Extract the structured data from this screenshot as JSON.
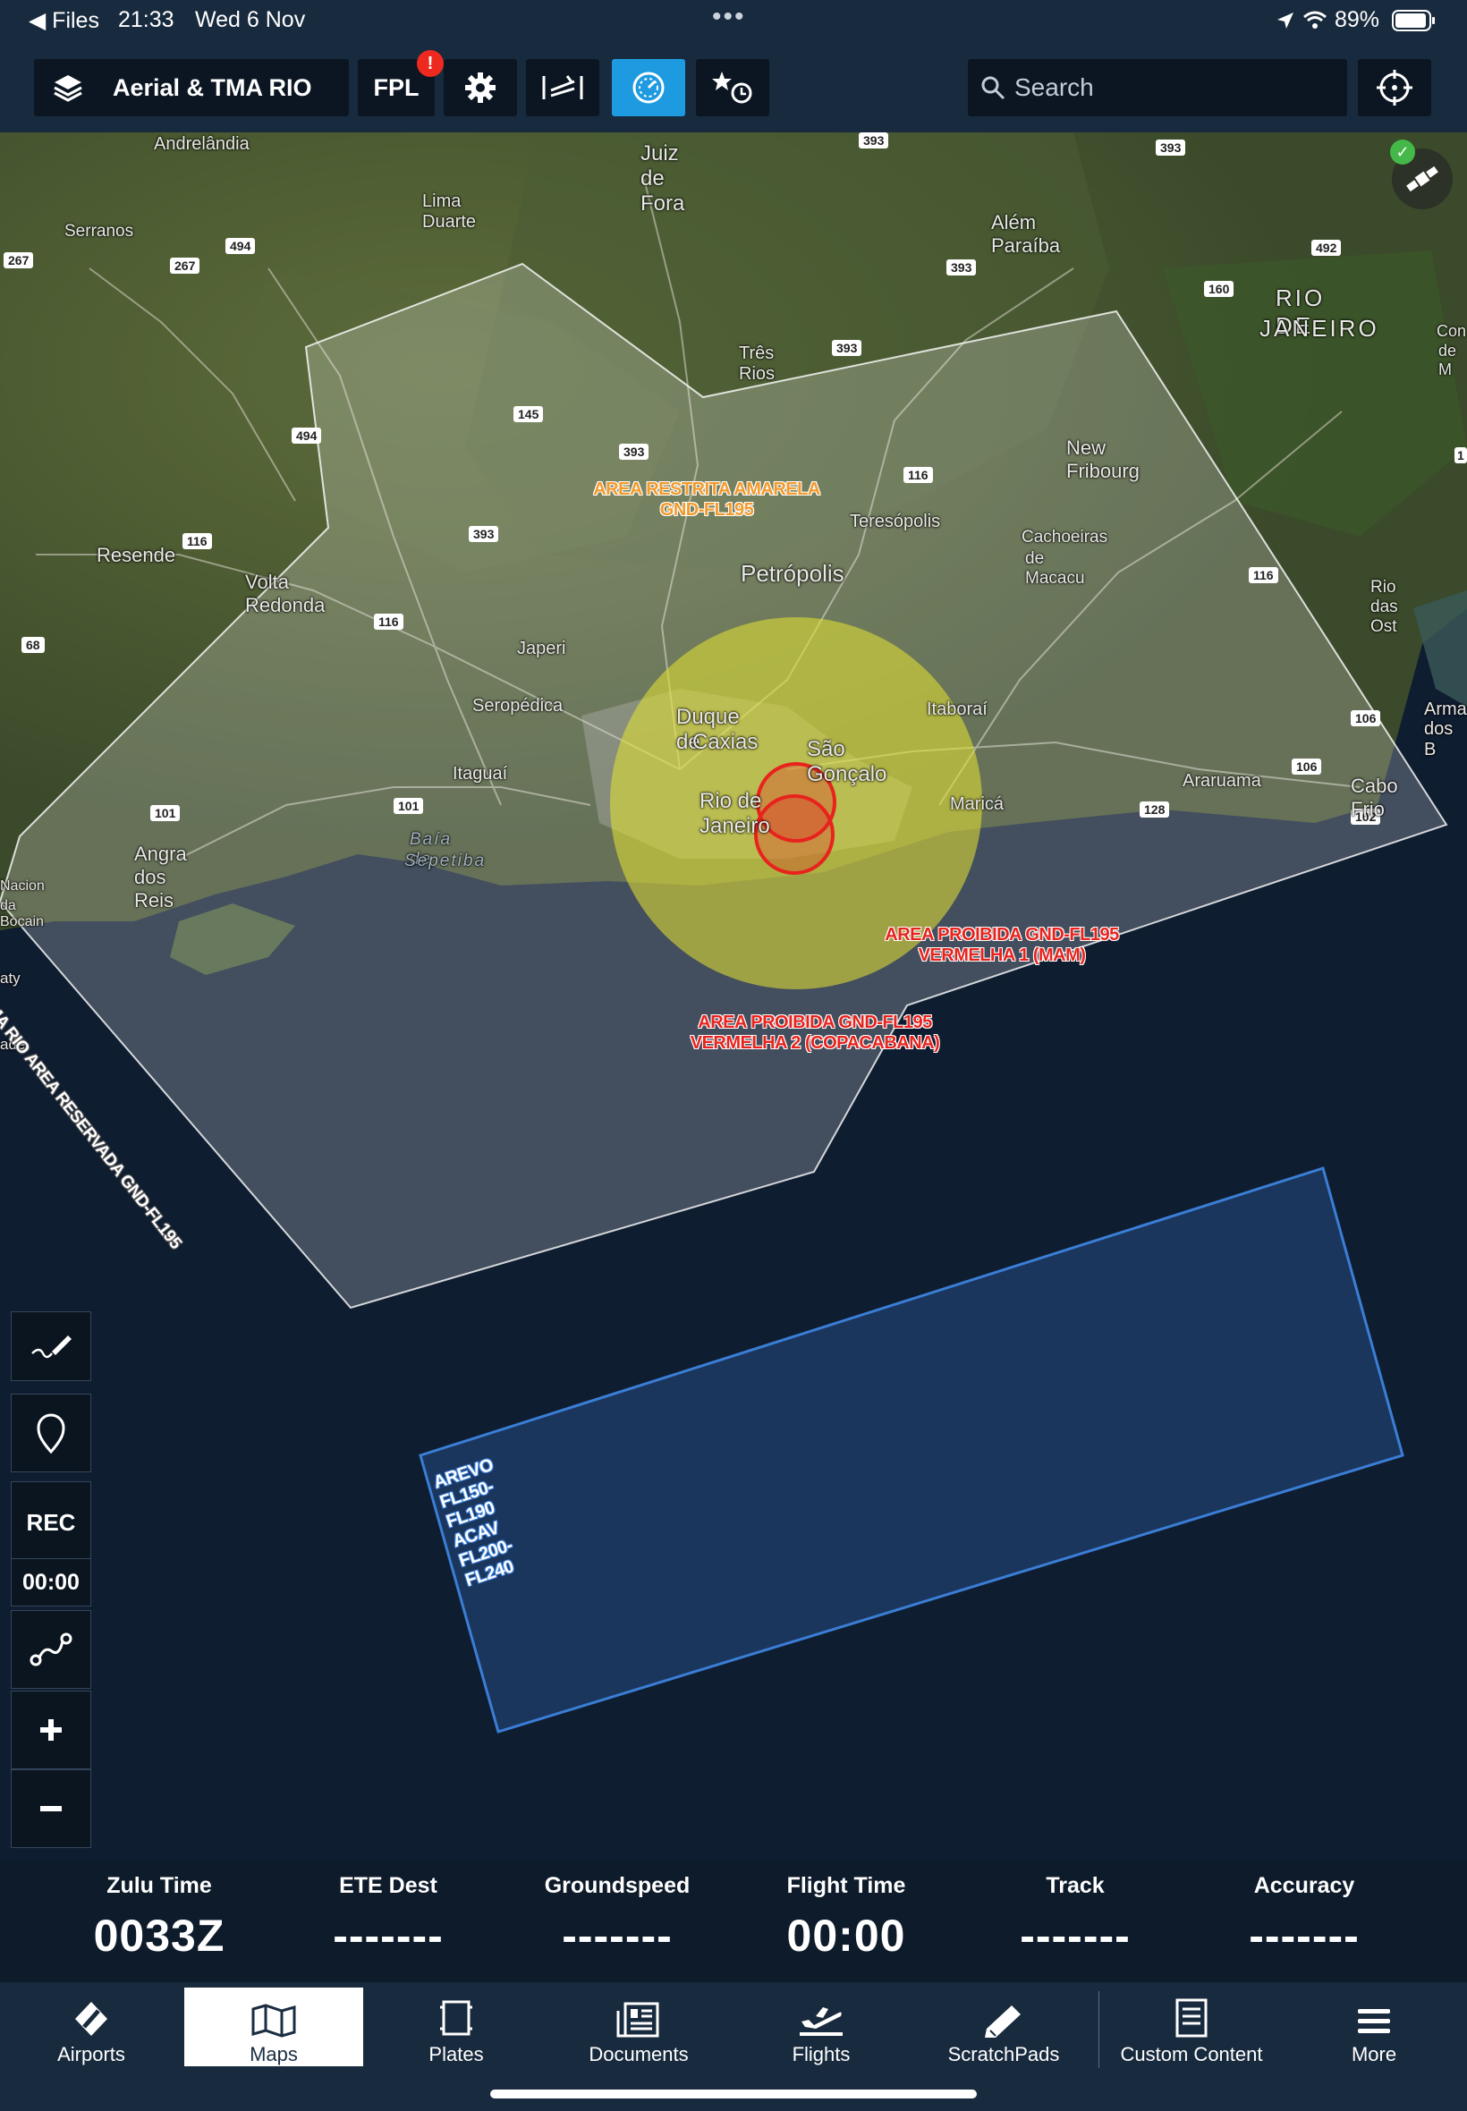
{
  "status_bar": {
    "back_app": "Files",
    "time": "21:33",
    "date": "Wed 6 Nov",
    "battery": "89%"
  },
  "toolbar": {
    "layer_name": "Aerial & TMA RIO",
    "fpl_label": "FPL",
    "fpl_badge": "!",
    "search_placeholder": "Search",
    "icons": [
      "layers-icon",
      "settings-icon",
      "wind-barbs-icon",
      "instrument-gauge-icon",
      "favorites-recents-icon",
      "search-icon",
      "locate-icon"
    ]
  },
  "map": {
    "place_labels": [
      {
        "text": "Andrelândia"
      },
      {
        "text": "Juiz de Fora"
      },
      {
        "text": "Serranos"
      },
      {
        "text": "Lima Duarte"
      },
      {
        "text": "Além Paraíba"
      },
      {
        "text": "RIO DE"
      },
      {
        "text": "JANEIRO"
      },
      {
        "text": "Três Rios"
      },
      {
        "text": "New Fribourg"
      },
      {
        "text": "Teresópolis"
      },
      {
        "text": "Cachoeiras"
      },
      {
        "text": "de Macacu"
      },
      {
        "text": "Petrópolis"
      },
      {
        "text": "Resende"
      },
      {
        "text": "Volta Redonda"
      },
      {
        "text": "Rio das Ost"
      },
      {
        "text": "Japeri"
      },
      {
        "text": "Seropédica"
      },
      {
        "text": "Duque de"
      },
      {
        "text": "Caxias"
      },
      {
        "text": "São Gonçalo"
      },
      {
        "text": "Itaboraí"
      },
      {
        "text": "Itaguaí"
      },
      {
        "text": "Rio de Janeiro"
      },
      {
        "text": "Maricá"
      },
      {
        "text": "Araruama"
      },
      {
        "text": "Cabo Frio"
      },
      {
        "text": "Arma"
      },
      {
        "text": "dos B"
      },
      {
        "text": "Angra dos Reis"
      },
      {
        "text": "Baía de"
      },
      {
        "text": "Sepetiba"
      },
      {
        "text": "Con"
      },
      {
        "text": "de M"
      },
      {
        "text": "Nacion"
      },
      {
        "text": "da Bocain"
      },
      {
        "text": "aty"
      },
      {
        "text": "ade"
      }
    ],
    "road_shields": [
      "267",
      "267",
      "494",
      "494",
      "393",
      "393",
      "393",
      "393",
      "393",
      "393",
      "145",
      "116",
      "116",
      "116",
      "116",
      "160",
      "492",
      "101",
      "101",
      "101",
      "106",
      "106",
      "128",
      "102",
      "68",
      "1"
    ],
    "airspace_labels": {
      "amarela_line1": "AREA RESTRITA AMARELA",
      "amarela_line2": "GND-FL195",
      "vermelha1_line1": "AREA PROIBIDA GND-FL195",
      "vermelha1_line2": "VERMELHA 1 (MAM)",
      "vermelha2_line1": "AREA PROIBIDA GND-FL195",
      "vermelha2_line2": "VERMELHA 2 (COPACABANA)",
      "tma_line": "TMA RIO AREA RESERVADA GND-FL195",
      "arevo_line1": "AREVO FL150-FL190",
      "arevo_line2": "ACAV FL200-FL240"
    },
    "gps_status": "connected",
    "side_controls": {
      "rec_label": "REC",
      "rec_time": "00:00",
      "icons": [
        "draw-icon",
        "place-marker-icon",
        "route-icon",
        "zoom-in-icon",
        "zoom-out-icon"
      ]
    },
    "colors": {
      "tma": "#ffffff",
      "restricted": "#e0e034",
      "prohibited": "#e8231e",
      "arevo": "#3a7ed6"
    }
  },
  "instruments": [
    {
      "label": "Zulu Time",
      "value": "0033Z"
    },
    {
      "label": "ETE Dest",
      "value": "-------"
    },
    {
      "label": "Groundspeed",
      "value": "-------"
    },
    {
      "label": "Flight Time",
      "value": "00:00"
    },
    {
      "label": "Track",
      "value": "-------"
    },
    {
      "label": "Accuracy",
      "value": "-------"
    }
  ],
  "tabs": [
    {
      "label": "Airports",
      "icon": "airports-icon"
    },
    {
      "label": "Maps",
      "icon": "maps-icon",
      "active": true
    },
    {
      "label": "Plates",
      "icon": "plates-icon"
    },
    {
      "label": "Documents",
      "icon": "documents-icon"
    },
    {
      "label": "Flights",
      "icon": "flights-icon"
    },
    {
      "label": "ScratchPads",
      "icon": "scratchpads-icon"
    },
    {
      "label": "Custom Content",
      "icon": "custom-content-icon"
    },
    {
      "label": "More",
      "icon": "more-icon"
    }
  ]
}
